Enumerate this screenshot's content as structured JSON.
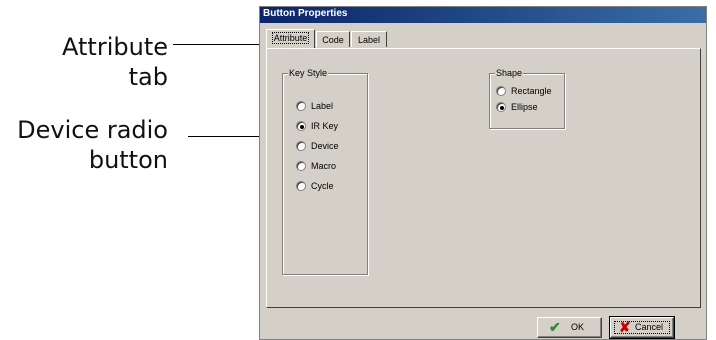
{
  "callouts": {
    "attribute_tab": [
      "Attribute",
      "tab"
    ],
    "device_radio": [
      "Device radio",
      "button"
    ]
  },
  "dialog": {
    "title": "Button Properties",
    "tabs": [
      {
        "label": "Attribute",
        "active": true
      },
      {
        "label": "Code",
        "active": false
      },
      {
        "label": "Label",
        "active": false
      }
    ],
    "key_style": {
      "legend": "Key Style",
      "options": [
        {
          "label": "Label",
          "checked": false
        },
        {
          "label": "IR Key",
          "checked": true
        },
        {
          "label": "Device",
          "checked": false
        },
        {
          "label": "Macro",
          "checked": false
        },
        {
          "label": "Cycle",
          "checked": false
        }
      ]
    },
    "shape": {
      "legend": "Shape",
      "options": [
        {
          "label": "Rectangle",
          "checked": false
        },
        {
          "label": "Ellipse",
          "checked": true
        }
      ]
    },
    "buttons": {
      "ok": "OK",
      "cancel": "Cancel"
    }
  },
  "colors": {
    "dialog_bg": "#d4d0c8",
    "titlebar_start": "#0a246a",
    "ok_check": "#2e8b2e",
    "cancel_x": "#cc0000"
  }
}
